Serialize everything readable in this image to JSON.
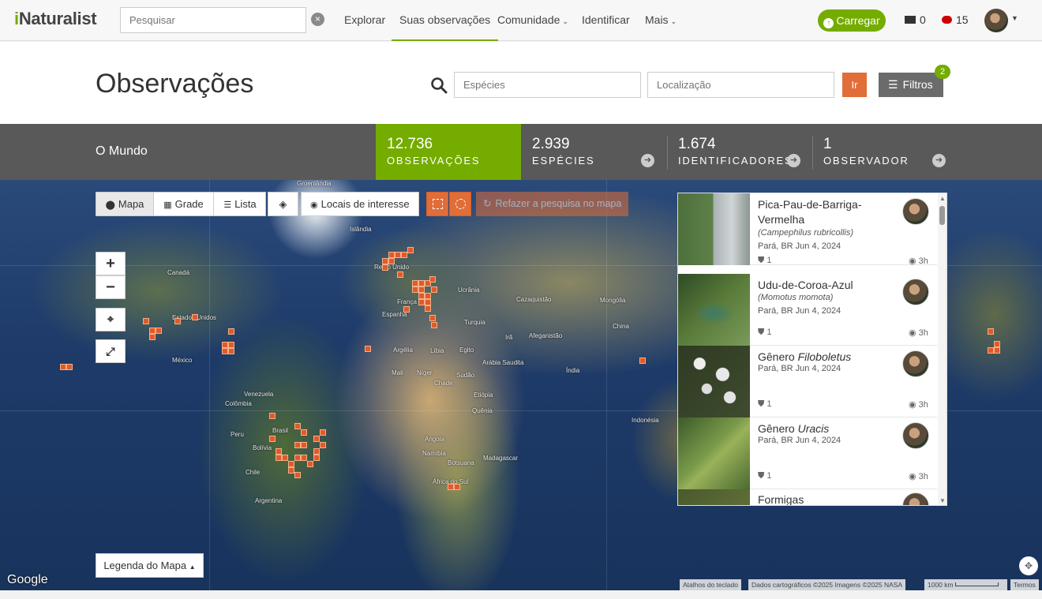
{
  "nav": {
    "logo_i": "i",
    "logo_rest": "Naturalist",
    "search_placeholder": "Pesquisar",
    "clear_symbol": "×",
    "links": [
      "Explorar",
      "Suas observações",
      "Comunidade",
      "Identificar",
      "Mais"
    ],
    "upload_label": "Carregar",
    "messages_count": "0",
    "notifications_count": "15"
  },
  "title_bar": {
    "title": "Observações",
    "species_placeholder": "Espécies",
    "location_placeholder": "Localização",
    "go_label": "Ir",
    "filters_label": "Filtros",
    "filters_badge": "2"
  },
  "stats": {
    "place": "O Mundo",
    "items": [
      {
        "num": "12.736",
        "label": "OBSERVAÇÕES"
      },
      {
        "num": "2.939",
        "label": "ESPÉCIES"
      },
      {
        "num": "1.674",
        "label": "IDENTIFICADORES"
      },
      {
        "num": "1",
        "label": "OBSERVADOR"
      }
    ]
  },
  "map_toolbar": {
    "map_label": "Mapa",
    "grid_label": "Grade",
    "list_label": "Lista",
    "places_label": "Locais de interesse",
    "redo_label": "Refazer a pesquisa no mapa",
    "legend_label": "Legenda do Mapa"
  },
  "map": {
    "google": "Google",
    "attrib_shortcuts": "Atalhos do teclado",
    "attrib_data": "Dados cartográficos ©2025 Imagens ©2025 NASA",
    "attrib_scale": "1000 km",
    "attrib_terms": "Termos",
    "labels": [
      "Groenlândia",
      "Islândia",
      "Reino Unido",
      "França",
      "Ucrânia",
      "Espanha",
      "Turquia",
      "Argélia",
      "Egito",
      "Líbia",
      "Mali",
      "Níger",
      "Chade",
      "Sudão",
      "Etiópia",
      "Quênia",
      "Angola",
      "Namíbia",
      "Botsuana",
      "Madagascar",
      "África do Sul",
      "Canadá",
      "Estados Unidos",
      "México",
      "Venezuela",
      "Colômbia",
      "Peru",
      "Brasil",
      "Bolívia",
      "Chile",
      "Argentina",
      "Cazaquistão",
      "Mongólia",
      "China",
      "Irã",
      "Índia",
      "Afeganistão",
      "Arábia Saudita",
      "Indonésia"
    ]
  },
  "observations": [
    {
      "name": "Pica-Pau-de-Barriga-Vermelha",
      "sci": "(Campephilus rubricollis)",
      "meta": "Pará, BR Jun 4, 2024",
      "ids": "1",
      "time": "3h"
    },
    {
      "name": "Udu-de-Coroa-Azul",
      "sci": "(Momotus momota)",
      "meta": "Pará, BR Jun 4, 2024",
      "ids": "1",
      "time": "3h"
    },
    {
      "name_prefix": "Gênero ",
      "name_italic": "Filoboletus",
      "meta": "Pará, BR Jun 4, 2024",
      "ids": "1",
      "time": "3h"
    },
    {
      "name_prefix": "Gênero ",
      "name_italic": "Uracis",
      "meta": "Pará, BR Jun 4, 2024",
      "ids": "1",
      "time": "3h"
    },
    {
      "name": "Formigas"
    }
  ]
}
